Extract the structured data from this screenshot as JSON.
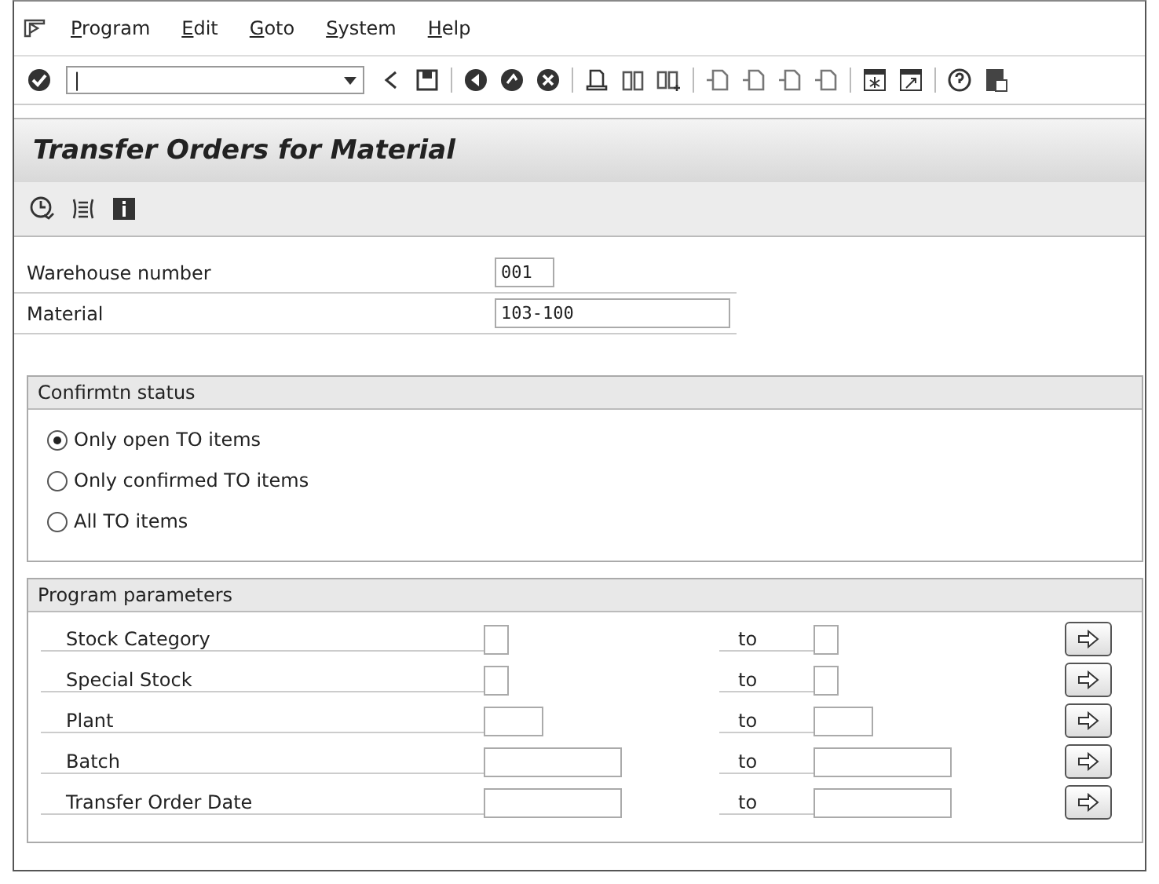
{
  "menu": [
    {
      "label": "Program"
    },
    {
      "label": "Edit"
    },
    {
      "label": "Goto"
    },
    {
      "label": "System"
    },
    {
      "label": "Help"
    }
  ],
  "command_field": {
    "value": "|"
  },
  "title": "Transfer Orders for Material",
  "header_fields": [
    {
      "label": "Warehouse number",
      "value": "001",
      "kind": "short"
    },
    {
      "label": "Material",
      "value": "103-100",
      "kind": "wide"
    }
  ],
  "confirmation_group": {
    "title": "Confirmtn status",
    "options": [
      {
        "label": "Only open TO items",
        "selected": true
      },
      {
        "label": "Only confirmed TO items",
        "selected": false
      },
      {
        "label": "All TO items",
        "selected": false
      }
    ]
  },
  "parameters_group": {
    "title": "Program parameters",
    "rows": [
      {
        "label": "Stock Category",
        "to": "to",
        "kind": "narrow"
      },
      {
        "label": "Special Stock",
        "to": "to",
        "kind": "narrow"
      },
      {
        "label": "Plant",
        "to": "to",
        "kind": "short"
      },
      {
        "label": "Batch",
        "to": "to",
        "kind": "wide"
      },
      {
        "label": "Transfer Order Date",
        "to": "to",
        "kind": "wide"
      }
    ]
  }
}
